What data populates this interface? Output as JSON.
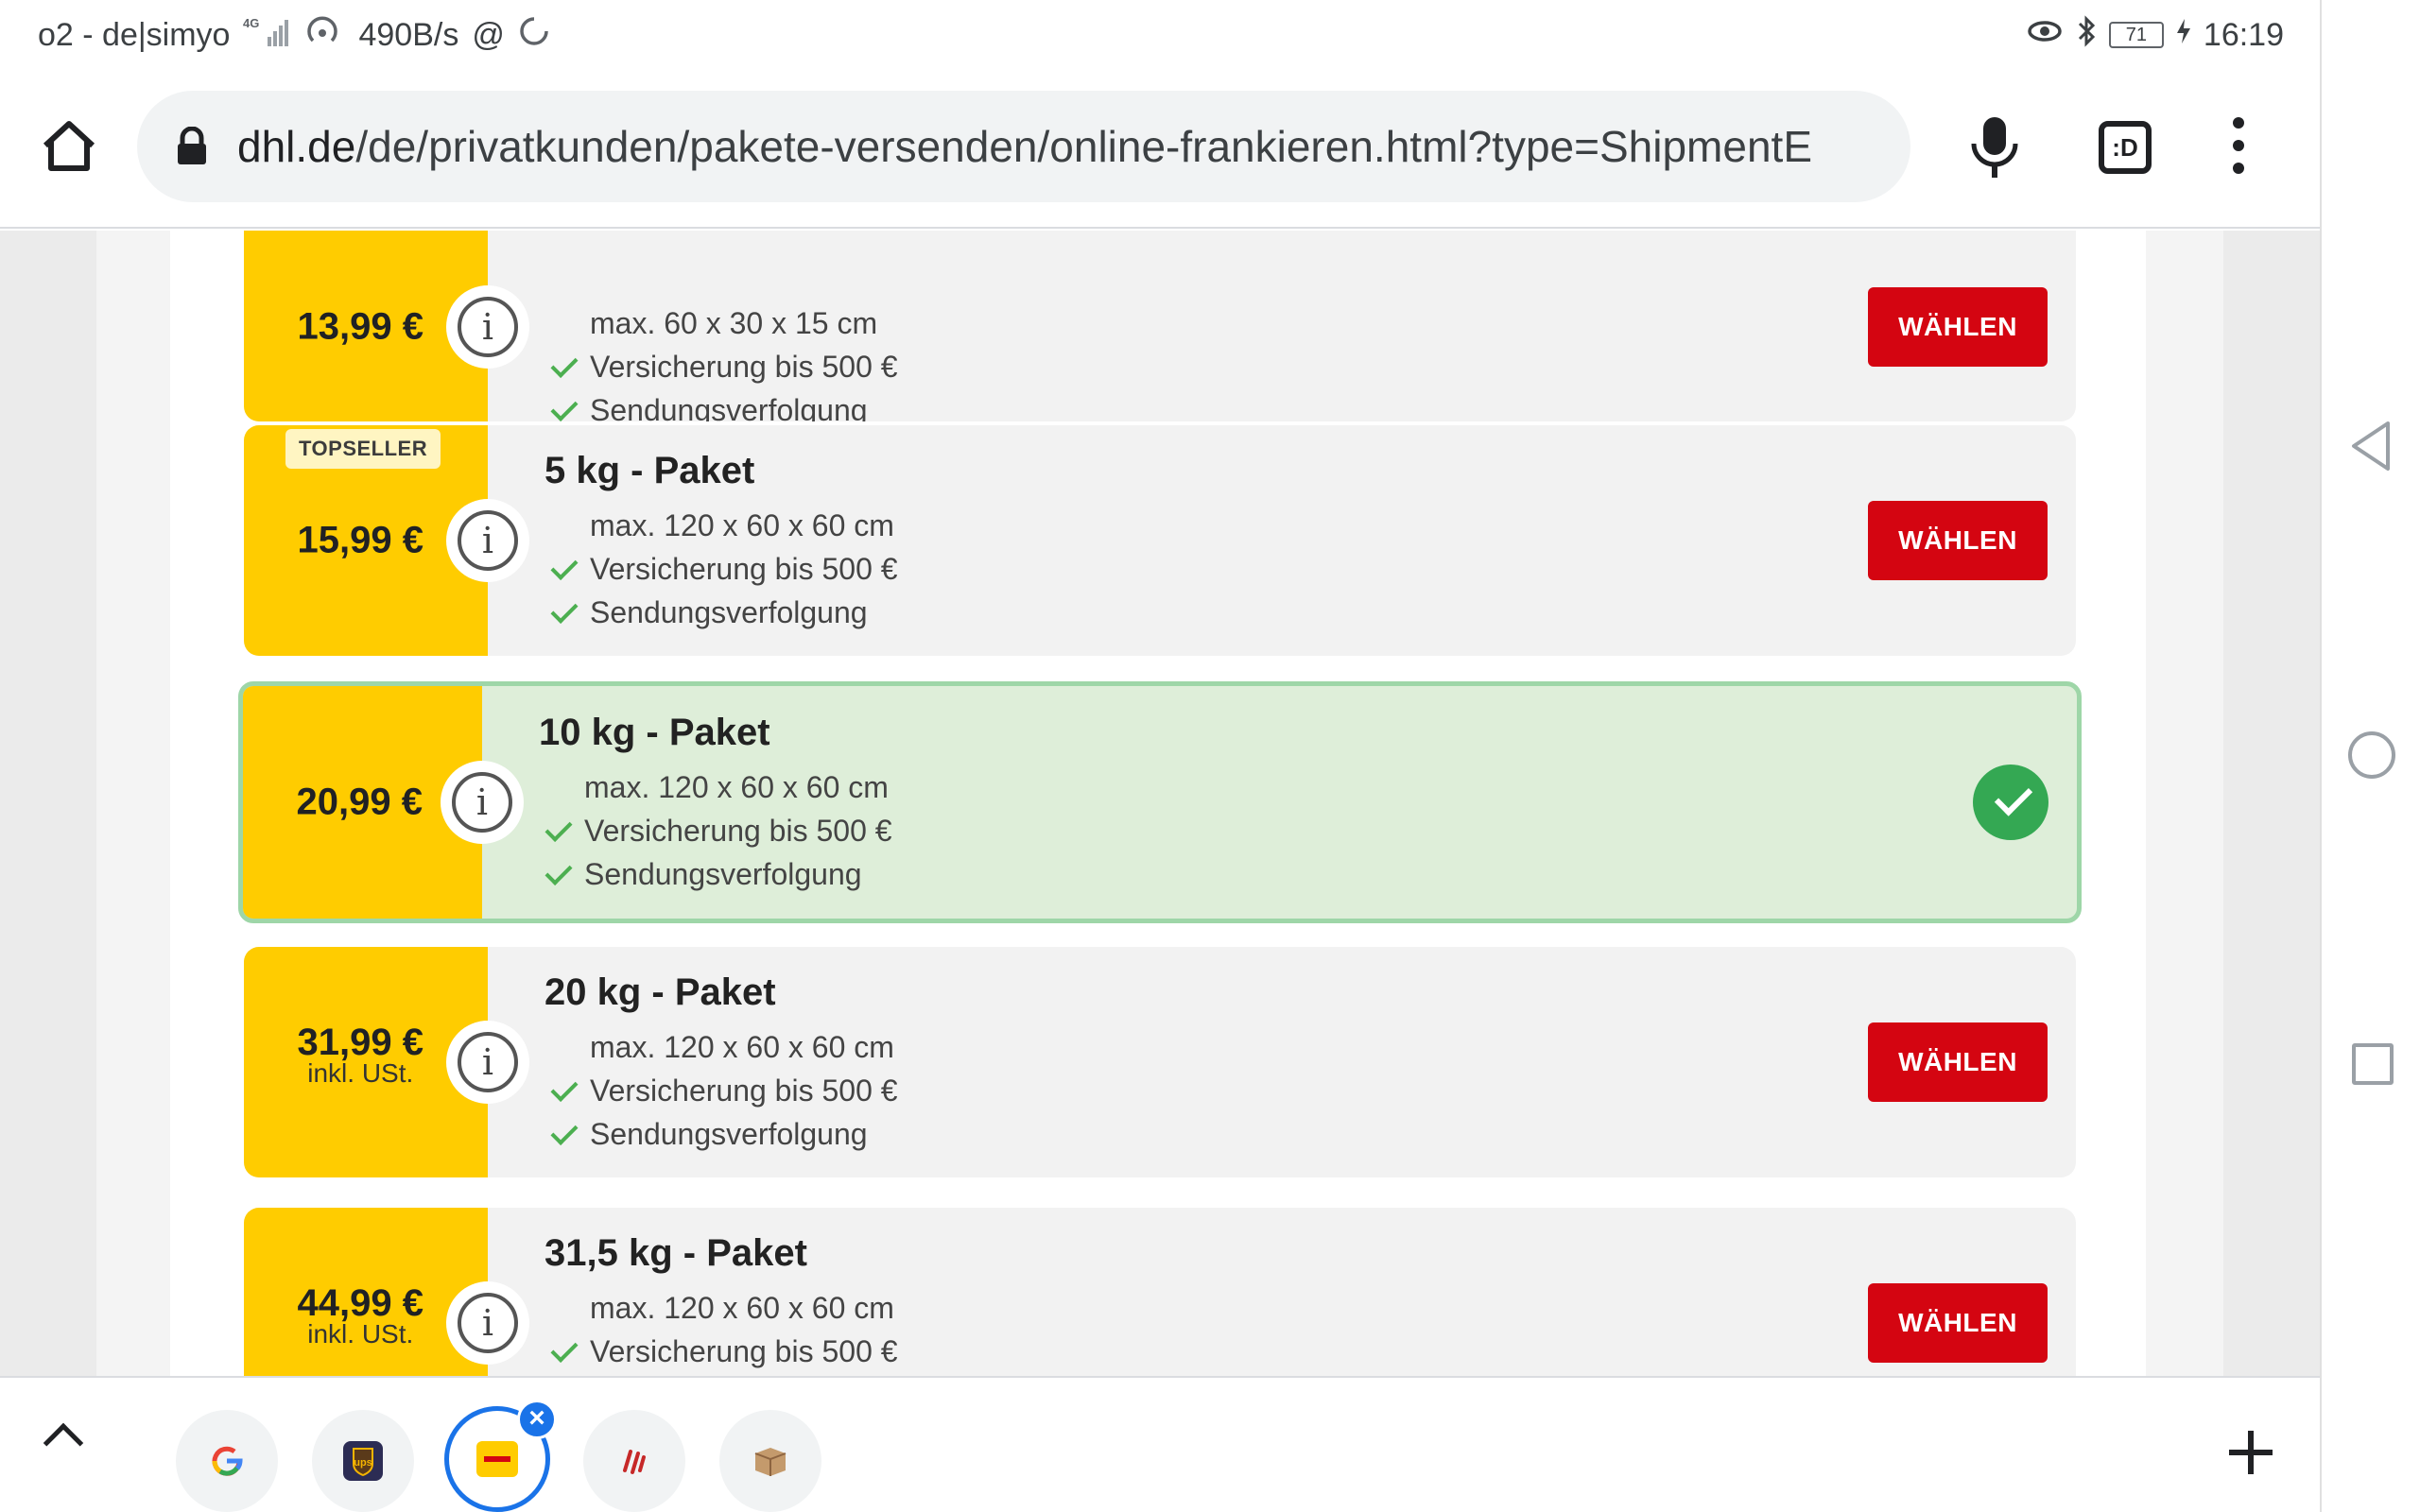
{
  "status_bar": {
    "carrier": "o2 - de|simyo",
    "network": "4G",
    "speed": "490B/s",
    "battery": "71",
    "time": "16:19"
  },
  "browser": {
    "url_domain": "dhl.de",
    "url_path": "/de/privatkunden/pakete-versenden/online-frankieren.html?type=ShipmentE",
    "tabs_label": ":D"
  },
  "products": [
    {
      "title": "",
      "price": "13,99 €",
      "price_sub": "",
      "badge": "",
      "dims": "max. 60 x 30 x 15 cm",
      "features": [
        "Versicherung bis 500 €",
        "Sendungsverfolgung"
      ],
      "button": "WÄHLEN",
      "selected": false
    },
    {
      "title": "5 kg - Paket",
      "price": "15,99 €",
      "price_sub": "",
      "badge": "TOPSELLER",
      "dims": "max. 120 x 60 x 60 cm",
      "features": [
        "Versicherung bis 500 €",
        "Sendungsverfolgung"
      ],
      "button": "WÄHLEN",
      "selected": false
    },
    {
      "title": "10 kg - Paket",
      "price": "20,99 €",
      "price_sub": "",
      "badge": "",
      "dims": "max. 120 x 60 x 60 cm",
      "features": [
        "Versicherung bis 500 €",
        "Sendungsverfolgung"
      ],
      "button": "",
      "selected": true
    },
    {
      "title": "20 kg - Paket",
      "price": "31,99 €",
      "price_sub": "inkl. USt.",
      "badge": "",
      "dims": "max. 120 x 60 x 60 cm",
      "features": [
        "Versicherung bis 500 €",
        "Sendungsverfolgung"
      ],
      "button": "WÄHLEN",
      "selected": false
    },
    {
      "title": "31,5 kg - Paket",
      "price": "44,99 €",
      "price_sub": "inkl. USt.",
      "badge": "",
      "dims": "max. 120 x 60 x 60 cm",
      "features": [
        "Versicherung bis 500 €"
      ],
      "button": "WÄHLEN",
      "selected": false
    }
  ],
  "tabstrip": {
    "tabs": [
      "google-tab",
      "ups-tab",
      "dhl-tab",
      "tab-4",
      "tab-5"
    ],
    "active_tab": "dhl-tab",
    "close_symbol": "×"
  },
  "colors": {
    "dhl_yellow": "#ffcc00",
    "dhl_red": "#d40511",
    "selected_bg": "#deeed9",
    "check_green": "#4caf50",
    "active_tab_blue": "#1a73e8"
  },
  "info_glyph": "i"
}
